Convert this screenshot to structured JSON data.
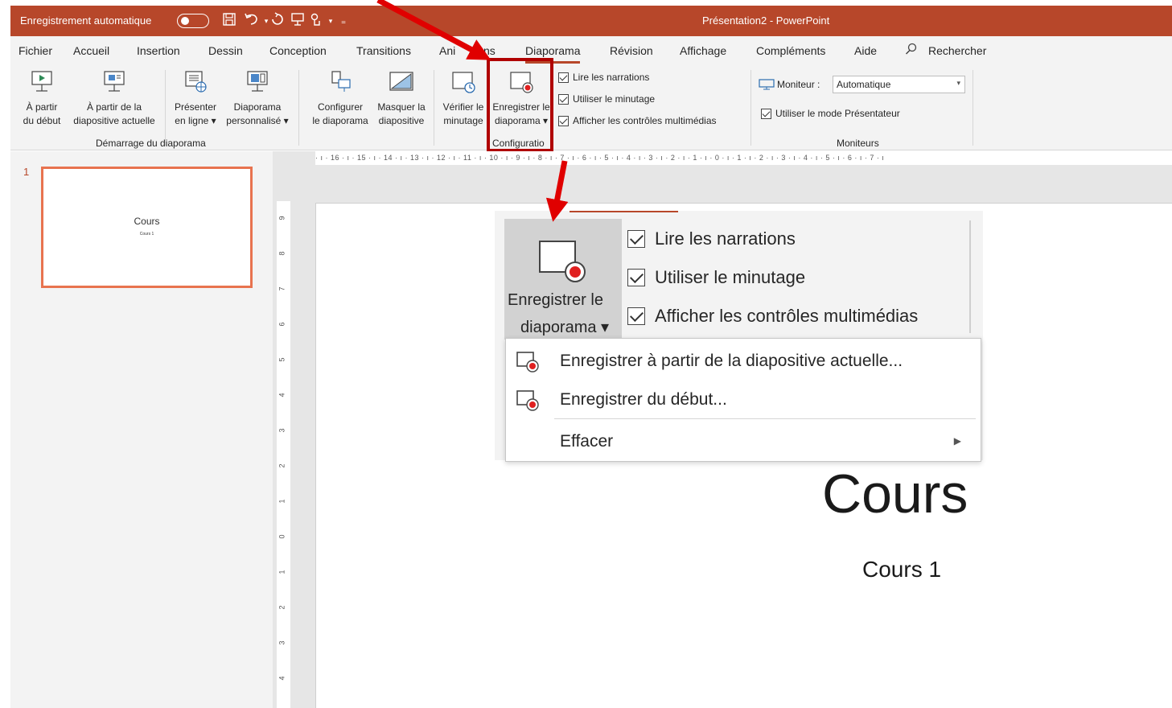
{
  "titlebar": {
    "autosave_label": "Enregistrement automatique",
    "document_title": "Présentation2  -  PowerPoint"
  },
  "tabs": [
    {
      "label": "Fichier"
    },
    {
      "label": "Accueil"
    },
    {
      "label": "Insertion"
    },
    {
      "label": "Dessin"
    },
    {
      "label": "Conception"
    },
    {
      "label": "Transitions"
    },
    {
      "label": "Ani"
    },
    {
      "label": "ns"
    },
    {
      "label": "Diaporama"
    },
    {
      "label": "Révision"
    },
    {
      "label": "Affichage"
    },
    {
      "label": "Compléments"
    },
    {
      "label": "Aide"
    },
    {
      "label": "Rechercher"
    }
  ],
  "ribbon": {
    "from_start": {
      "line1": "À partir",
      "line2": "du début"
    },
    "from_current": {
      "line1": "À partir de la",
      "line2": "diapositive actuelle"
    },
    "present_online": {
      "line1": "Présenter",
      "line2": "en ligne ▾"
    },
    "custom_show": {
      "line1": "Diaporama",
      "line2": "personnalisé ▾"
    },
    "group_start": "Démarrage du diaporama",
    "setup_show": {
      "line1": "Configurer",
      "line2": "le diaporama"
    },
    "hide_slide": {
      "line1": "Masquer la",
      "line2": "diapositive"
    },
    "rehearse": {
      "line1": "Vérifier le",
      "line2": "minutage"
    },
    "record": {
      "line1": "Enregistrer le",
      "line2": "diaporama ▾"
    },
    "group_setup": "Configuratio",
    "chk_narrations": "Lire les narrations",
    "chk_timings": "Utiliser le minutage",
    "chk_media": "Afficher les contrôles multimédias",
    "monitor_label": "Moniteur :",
    "monitor_value": "Automatique",
    "chk_presenter": "Utiliser le mode Présentateur",
    "group_monitors": "Moniteurs"
  },
  "ruler": {
    "horizontal": "· ı · 16 · ı · 15 · ı · 14 · ı · 13 · ı · 12 · ı · 11 · ı · 10 · ı · 9 · ı · 8 · ı · 7 · ı · 6 · ı · 5 · ı · 4 · ı · 3 · ı · 2 · ı · 1 · ı · 0 · ı · 1 · ı · 2 · ı · 3 · ı · 4 · ı · 5 · ı · 6 · ı · 7 · ı",
    "vertical": [
      "9",
      "8",
      "7",
      "6",
      "5",
      "4",
      "3",
      "2",
      "1",
      "0",
      "1",
      "2",
      "3",
      "4"
    ]
  },
  "slide_pane": {
    "slide_number": "1",
    "thumb_title": "Cours",
    "thumb_subtitle": "Cours 1"
  },
  "slide": {
    "title": "Cours",
    "subtitle": "Cours 1"
  },
  "zoom": {
    "record_line1": "Enregistrer le",
    "record_line2": "diaporama ▾",
    "chk_narrations": "Lire les narrations",
    "chk_timings": "Utiliser le minutage",
    "chk_media": "Afficher les contrôles multimédias"
  },
  "menu": {
    "items": [
      {
        "label": "Enregistrer à partir de la diapositive actuelle..."
      },
      {
        "label": "Enregistrer du début..."
      },
      {
        "label": "Effacer"
      }
    ]
  },
  "colors": {
    "accent": "#b7472a",
    "highlight": "#b00000",
    "arrow": "#e00000"
  }
}
